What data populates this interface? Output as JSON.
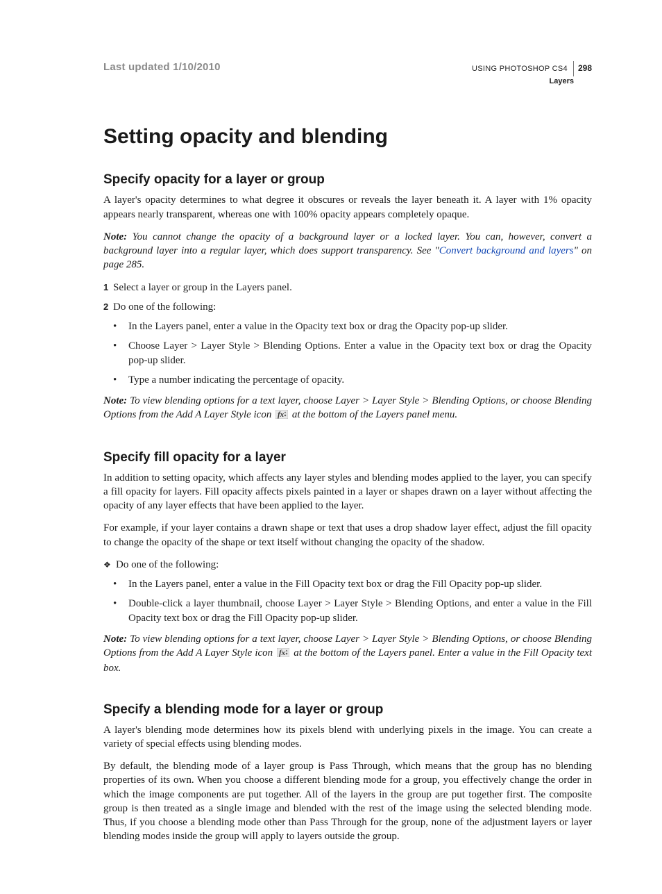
{
  "header": {
    "last_updated": "Last updated 1/10/2010",
    "doc_title": "USING PHOTOSHOP CS4",
    "page_number": "298",
    "section": "Layers"
  },
  "h1": "Setting opacity and blending",
  "sec1": {
    "title": "Specify opacity for a layer or group",
    "p1": "A layer's opacity determines to what degree it obscures or reveals the layer beneath it. A layer with 1% opacity appears nearly transparent, whereas one with 100% opacity appears completely opaque.",
    "note1_label": "Note:",
    "note1_a": " You cannot change the opacity of a background layer or a locked layer. You can, however, convert a background layer into a regular layer, which does support transparency. See \"",
    "note1_link": "Convert background and layers",
    "note1_b": "\" on page 285.",
    "step1": "Select a layer or group in the Layers panel.",
    "step2": "Do one of the following:",
    "b1": "In the Layers panel, enter a value in the Opacity text box or drag the Opacity pop-up slider.",
    "b2": "Choose Layer > Layer Style > Blending Options. Enter a value in the Opacity text box or drag the Opacity pop-up slider.",
    "b3": "Type a number indicating the percentage of opacity.",
    "note2_label": "Note:",
    "note2_a": " To view blending options for a text layer, choose Layer > Layer Style > Blending Options, or choose Blending Options from the Add A Layer Style icon ",
    "note2_b": " at the bottom of the Layers panel menu."
  },
  "sec2": {
    "title": "Specify fill opacity for a layer",
    "p1": "In addition to setting opacity, which affects any layer styles and blending modes applied to the layer, you can specify a fill opacity for layers. Fill opacity affects pixels painted in a layer or shapes drawn on a layer without affecting the opacity of any layer effects that have been applied to the layer.",
    "p2": "For example, if your layer contains a drawn shape or text that uses a drop shadow layer effect, adjust the fill opacity to change the opacity of the shape or text itself without changing the opacity of the shadow.",
    "diamond": "Do one of the following:",
    "b1": "In the Layers panel, enter a value in the Fill Opacity text box or drag the Fill Opacity pop-up slider.",
    "b2": "Double-click a layer thumbnail, choose Layer > Layer Style > Blending Options, and enter a value in the Fill Opacity text box or drag the Fill Opacity pop-up slider.",
    "note_label": "Note:",
    "note_a": " To view blending options for a text layer, choose Layer > Layer Style > Blending Options, or choose Blending Options from the Add A Layer Style icon ",
    "note_b": " at the bottom of the Layers panel. Enter a value in the Fill Opacity text box."
  },
  "sec3": {
    "title": "Specify a blending mode for a layer or group",
    "p1": "A layer's blending mode determines how its pixels blend with underlying pixels in the image. You can create a variety of special effects using blending modes.",
    "p2": "By default, the blending mode of a layer group is Pass Through, which means that the group has no blending properties of its own. When you choose a different blending mode for a group, you effectively change the order in which the image components are put together. All of the layers in the group are put together first. The composite group is then treated as a single image and blended with the rest of the image using the selected blending mode. Thus, if you choose a blending mode other than Pass Through for the group, none of the adjustment layers or layer blending modes inside the group will apply to layers outside the group."
  }
}
